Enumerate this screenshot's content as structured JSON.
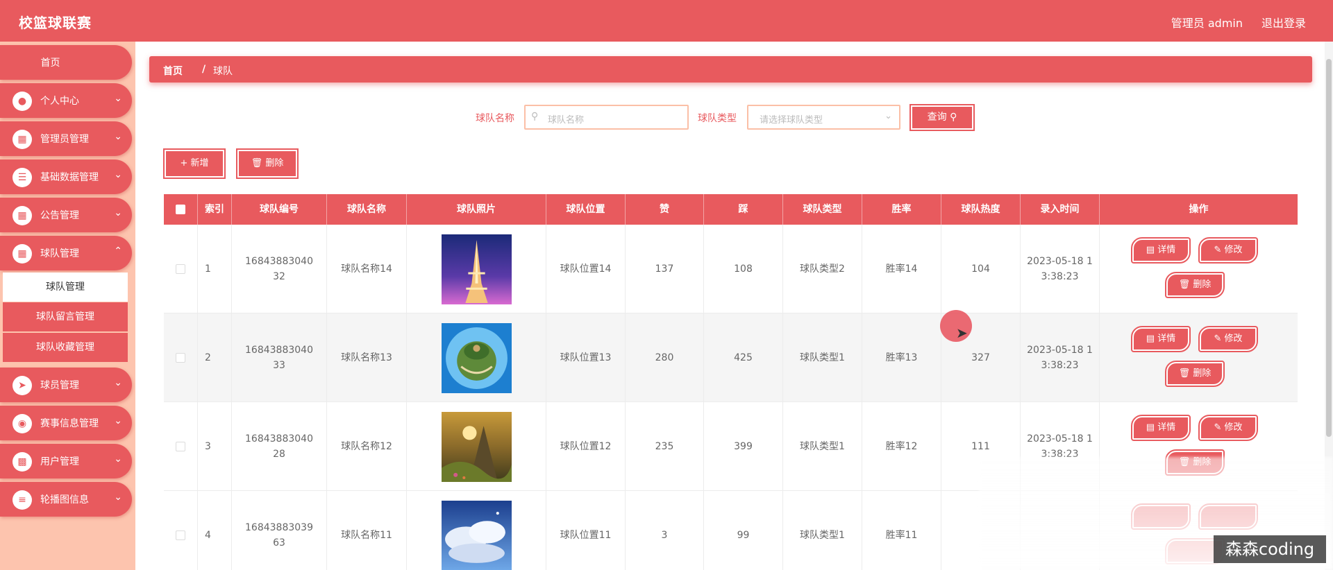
{
  "header": {
    "title": "校篮球联赛",
    "user": "管理员 admin",
    "logout": "退出登录"
  },
  "sidebar": {
    "home": "首页",
    "items": [
      {
        "label": "个人中心",
        "icon": "user-icon"
      },
      {
        "label": "管理员管理",
        "icon": "grid-icon"
      },
      {
        "label": "基础数据管理",
        "icon": "list-icon"
      },
      {
        "label": "公告管理",
        "icon": "grid-icon"
      },
      {
        "label": "球队管理",
        "icon": "grid-icon"
      },
      {
        "label": "球员管理",
        "icon": "send-icon"
      },
      {
        "label": "赛事信息管理",
        "icon": "location-icon"
      },
      {
        "label": "用户管理",
        "icon": "cart-icon"
      },
      {
        "label": "轮播图信息",
        "icon": "sliders-icon"
      }
    ],
    "submenu": [
      "球队管理",
      "球队留言管理",
      "球队收藏管理"
    ]
  },
  "breadcrumb": {
    "home": "首页",
    "sep": "/",
    "current": "球队"
  },
  "search": {
    "name_label": "球队名称",
    "name_placeholder": "球队名称",
    "type_label": "球队类型",
    "type_placeholder": "请选择球队类型",
    "query": "查询"
  },
  "actions": {
    "add": "+ 新增",
    "delete": "删除"
  },
  "table": {
    "headers": [
      "索引",
      "球队编号",
      "球队名称",
      "球队照片",
      "球队位置",
      "赞",
      "踩",
      "球队类型",
      "胜率",
      "球队热度",
      "录入时间",
      "操作"
    ],
    "rows": [
      {
        "idx": "1",
        "code": "1684388304032",
        "name": "球队名称14",
        "pos": "球队位置14",
        "like": "137",
        "dislike": "108",
        "type": "球队类型2",
        "rate": "胜率14",
        "heat": "104",
        "time": "2023-05-18 13:38:23"
      },
      {
        "idx": "2",
        "code": "1684388304033",
        "name": "球队名称13",
        "pos": "球队位置13",
        "like": "280",
        "dislike": "425",
        "type": "球队类型1",
        "rate": "胜率13",
        "heat": "327",
        "time": "2023-05-18 13:38:23"
      },
      {
        "idx": "3",
        "code": "1684388304028",
        "name": "球队名称12",
        "pos": "球队位置12",
        "like": "235",
        "dislike": "399",
        "type": "球队类型1",
        "rate": "胜率12",
        "heat": "111",
        "time": "2023-05-18 13:38:23"
      },
      {
        "idx": "4",
        "code": "1684388303963",
        "name": "球队名称11",
        "pos": "球队位置11",
        "like": "3",
        "dislike": "99",
        "type": "球队类型1",
        "rate": "胜率11",
        "heat": "",
        "time": ""
      }
    ],
    "op": {
      "detail": "详情",
      "edit": "修改",
      "delete": "删除"
    }
  },
  "watermark": "森森coding",
  "colors": {
    "primary": "#e85a5e",
    "sidebar_bg": "#fdc4ae"
  }
}
